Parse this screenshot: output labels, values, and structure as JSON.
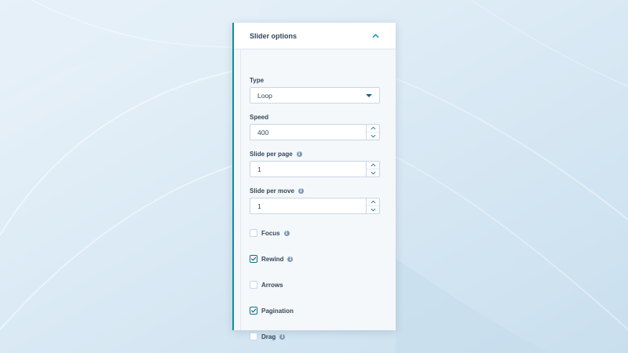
{
  "colors": {
    "accent": "#0c8fa6",
    "text": "#33475b",
    "border": "#cbd6e2",
    "panel_bg": "#f5f8fa",
    "info_icon": "#7c98b6",
    "check": "#0c6a8a"
  },
  "panel": {
    "title": "Slider options",
    "collapse_icon": "chevron-up-icon"
  },
  "fields": {
    "type": {
      "label": "Type",
      "value": "Loop"
    },
    "speed": {
      "label": "Speed",
      "value": "400"
    },
    "slide_per_page": {
      "label": "Slide per page",
      "value": "1",
      "info_icon": "info-icon"
    },
    "slide_per_move": {
      "label": "Slide per move",
      "value": "1",
      "info_icon": "info-icon"
    }
  },
  "checkboxes": {
    "focus": {
      "label": "Focus",
      "checked": false,
      "info": true
    },
    "rewind": {
      "label": "Rewind",
      "checked": true,
      "info": true
    },
    "arrows": {
      "label": "Arrows",
      "checked": false,
      "info": false
    },
    "pagination": {
      "label": "Pagination",
      "checked": true,
      "info": false
    },
    "drag": {
      "label": "Drag",
      "checked": false,
      "info": true
    }
  },
  "info_glyph": "i"
}
